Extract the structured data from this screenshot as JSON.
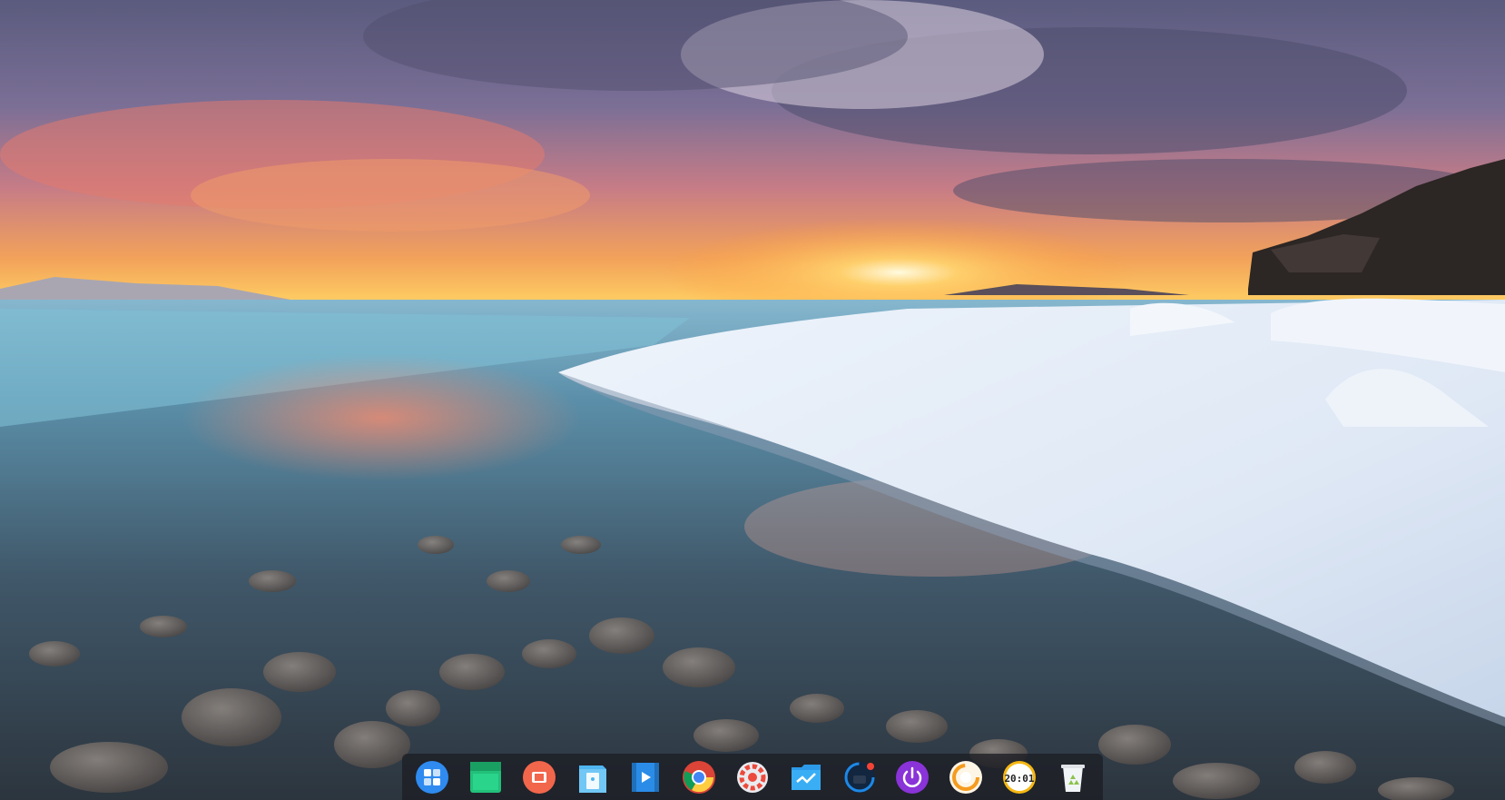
{
  "desktop": {
    "wallpaper": "sunset-over-frozen-lake"
  },
  "dock": {
    "items": [
      {
        "id": "launcher",
        "icon": "launcher-icon",
        "accent": "#2f8bf0"
      },
      {
        "id": "multitask-view",
        "icon": "multitask-view-icon",
        "accent": "#22c07a"
      },
      {
        "id": "screen-recorder",
        "icon": "screen-recorder-icon",
        "accent": "#f2664c"
      },
      {
        "id": "file-manager",
        "icon": "file-manager-icon",
        "accent": "#4fb6f0"
      },
      {
        "id": "movie-player",
        "icon": "movie-player-icon",
        "accent": "#2b8ce8"
      },
      {
        "id": "chrome",
        "icon": "chrome-icon",
        "accent": "#db4437"
      },
      {
        "id": "control-center",
        "icon": "control-center-icon",
        "accent": "#ec4a3c"
      },
      {
        "id": "system-monitor",
        "icon": "system-monitor-icon",
        "accent": "#2c9ae8"
      },
      {
        "id": "app-store",
        "icon": "app-store-icon",
        "accent": "#1e88e5"
      },
      {
        "id": "shutdown",
        "icon": "power-icon",
        "accent": "#8a33d8"
      },
      {
        "id": "deepin-music",
        "icon": "music-icon",
        "accent": "#f59b1e"
      },
      {
        "id": "clock",
        "icon": "clock-icon",
        "accent": "#f5b712",
        "label": "20:01"
      },
      {
        "id": "trash",
        "icon": "trash-icon",
        "accent": "#8bc34a"
      }
    ]
  }
}
